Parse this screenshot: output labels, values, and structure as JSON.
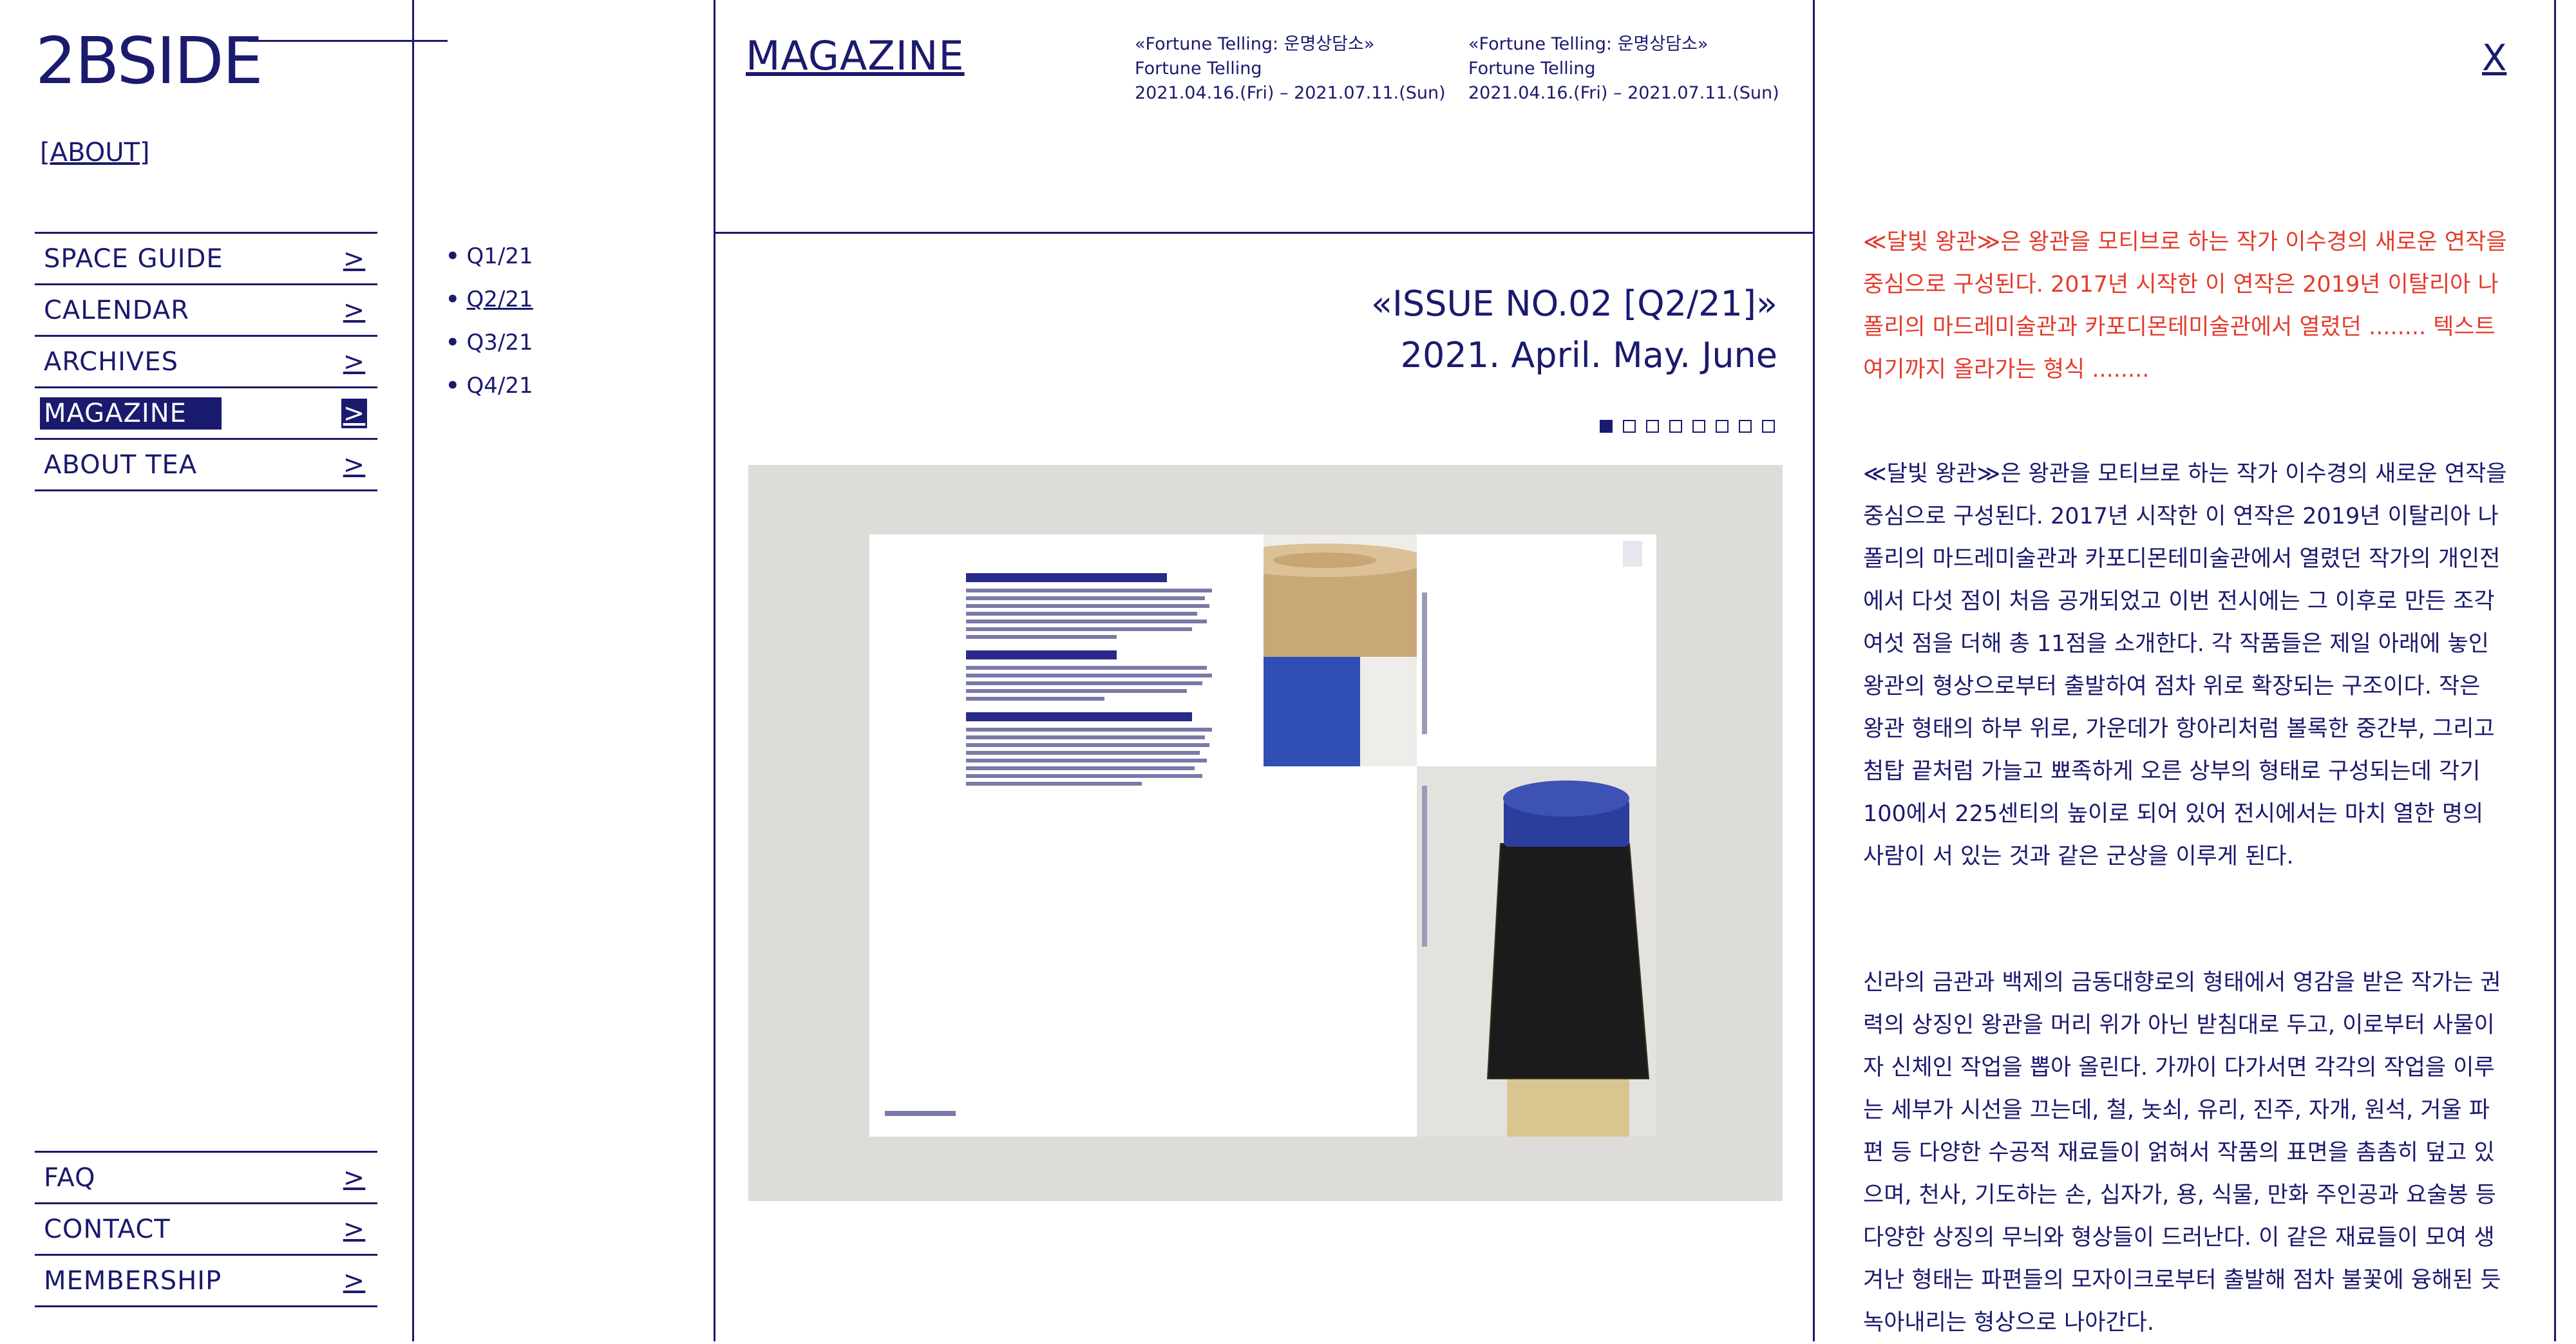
{
  "brand": {
    "logo": "2BSIDE",
    "about_link": "[ABOUT]"
  },
  "nav": {
    "main": [
      {
        "label": "SPACE GUIDE",
        "arrow": ">"
      },
      {
        "label": "CALENDAR",
        "arrow": ">"
      },
      {
        "label": "ARCHIVES",
        "arrow": ">"
      },
      {
        "label": "MAGAZINE",
        "arrow": ">",
        "active": true
      },
      {
        "label": "ABOUT TEA",
        "arrow": ">"
      }
    ],
    "footer": [
      {
        "label": "FAQ",
        "arrow": ">"
      },
      {
        "label": "CONTACT",
        "arrow": ">"
      },
      {
        "label": "MEMBERSHIP",
        "arrow": ">"
      }
    ]
  },
  "quarters": {
    "items": [
      "Q1/21",
      "Q2/21",
      "Q3/21",
      "Q4/21"
    ],
    "selected": "Q2/21",
    "bullet": "•"
  },
  "magazine": {
    "title": "MAGAZINE",
    "events": [
      {
        "title": "«Fortune Telling: 운명상담소»",
        "subtitle": "Fortune Telling",
        "dates": "2021.04.16.(Fri) – 2021.07.11.(Sun)"
      },
      {
        "title": "«Fortune Telling: 운명상담소»",
        "subtitle": "Fortune Telling",
        "dates": "2021.04.16.(Fri) – 2021.07.11.(Sun)"
      }
    ],
    "issue_title": "«ISSUE NO.02 [Q2/21]»",
    "issue_period": "2021. April. May. June",
    "pagination": {
      "total": 8,
      "current": 1
    },
    "close_label": "X"
  },
  "article": {
    "highlight": "≪달빛 왕관≫은 왕관을 모티브로 하는 작가 이수경의 새로운 연작을 중심으로 구성된다. 2017년 시작한 이 연작은 2019년 이탈리아 나폴리의 마드레미술관과 카포디몬테미술관에서 열렸던 ........ 텍스트 여기까지 올라가는 형식 ........",
    "paragraph1": "≪달빛 왕관≫은 왕관을 모티브로 하는 작가 이수경의 새로운 연작을 중심으로 구성된다. 2017년 시작한 이 연작은 2019년 이탈리아 나폴리의 마드레미술관과 카포디몬테미술관에서 열렸던 작가의 개인전에서 다섯 점이 처음 공개되었고 이번 전시에는 그 이후로 만든 조각 여섯 점을 더해 총 11점을 소개한다. 각 작품들은 제일 아래에 놓인 왕관의 형상으로부터 출발하여 점차 위로 확장되는 구조이다. 작은 왕관 형태의 하부 위로, 가운데가 항아리처럼 볼록한 중간부, 그리고 첨탑 끝처럼 가늘고 뾰족하게 오른 상부의 형태로 구성되는데 각기 100에서 225센티의 높이로 되어 있어 전시에서는 마치 열한 명의 사람이 서 있는 것과 같은 군상을 이루게 된다.",
    "paragraph2": "신라의 금관과 백제의 금동대향로의 형태에서 영감을 받은 작가는 권력의 상징인 왕관을 머리 위가 아닌 받침대로 두고, 이로부터 사물이자 신체인 작업을 뽑아 올린다. 가까이 다가서면 각각의 작업을 이루는 세부가 시선을 끄는데, 철, 놋쇠, 유리, 진주, 자개, 원석, 거울 파편 등 다양한 수공적 재료들이 얽혀서 작품의 표면을 촘촘히 덮고 있으며, 천사, 기도하는 손, 십자가, 용, 식물, 만화 주인공과 요술봉 등 다양한 상징의 무늬와 형상들이 드러난다. 이 같은 재료들이 모여 생겨난 형태는 파편들의 모자이크로부터 출발해 점차 불꽃에 융해된 듯 녹아내리는 형상으로 나아간다."
  },
  "colors": {
    "primary": "#1a1a6e",
    "highlight_text": "#e33c2d",
    "viewer_bg": "#dedcd8"
  }
}
